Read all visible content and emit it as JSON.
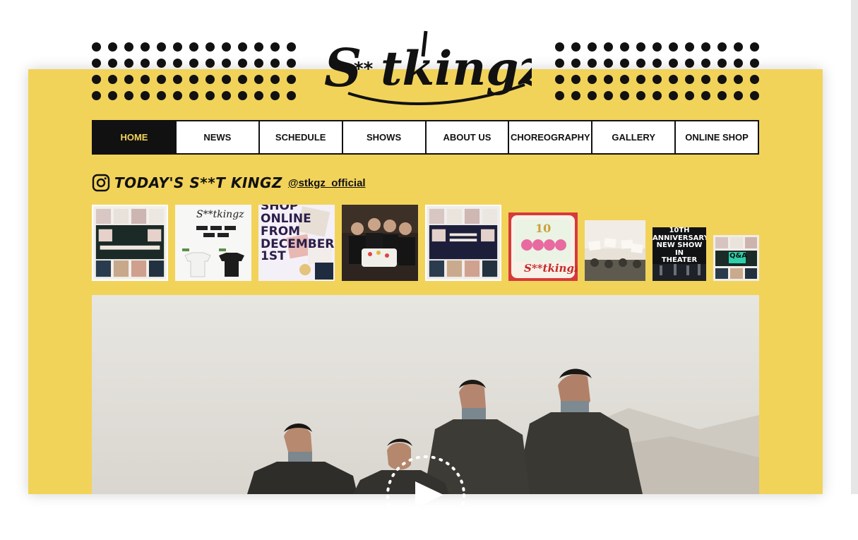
{
  "site": {
    "logo_text": "S**tkingz"
  },
  "nav": {
    "items": [
      {
        "label": "HOME",
        "active": true
      },
      {
        "label": "NEWS",
        "active": false
      },
      {
        "label": "SCHEDULE",
        "active": false
      },
      {
        "label": "SHOWS",
        "active": false
      },
      {
        "label": "ABOUT US",
        "active": false
      },
      {
        "label": "CHOREOGRAPHY",
        "active": false
      },
      {
        "label": "GALLERY",
        "active": false
      },
      {
        "label": "ONLINE SHOP",
        "active": false
      }
    ]
  },
  "instagram": {
    "icon": "instagram-icon",
    "title": "TODAY'S S**T KINGZ",
    "handle": "@stkgz_official",
    "posts": [
      {
        "name": "post-1"
      },
      {
        "name": "post-2"
      },
      {
        "name": "post-3",
        "lines": [
          "SHOP",
          "ONLINE",
          "FROM",
          "DECEMBER",
          "1ST"
        ]
      },
      {
        "name": "post-4"
      },
      {
        "name": "post-5"
      },
      {
        "name": "post-6"
      },
      {
        "name": "post-7"
      },
      {
        "name": "post-8",
        "lines": [
          "10TH ANNIVERSARY",
          "NEW SHOW",
          "IN",
          "THEATER"
        ]
      },
      {
        "name": "post-9",
        "badge": "Q&A"
      }
    ]
  },
  "hero": {
    "play_icon": "play-icon"
  },
  "colors": {
    "brand_yellow": "#f2d35a",
    "ink": "#111111"
  }
}
